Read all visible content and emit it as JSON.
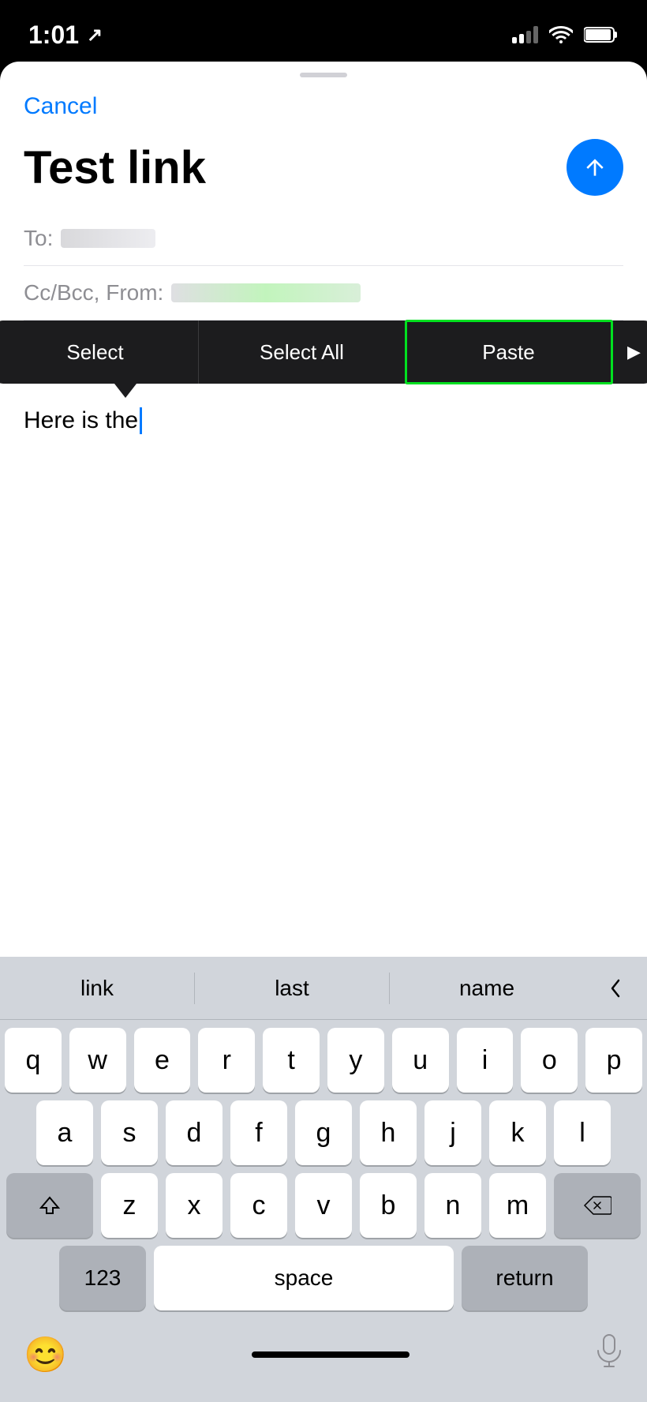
{
  "statusBar": {
    "time": "1:01",
    "locationIcon": "↗"
  },
  "sheet": {
    "cancelLabel": "Cancel",
    "emailTitle": "Test link",
    "toLabel": "To:",
    "ccBccLabel": "Cc/Bcc, From:",
    "bodyText": "Here is the",
    "contextMenu": {
      "selectLabel": "Select",
      "selectAllLabel": "Select All",
      "pasteLabel": "Paste",
      "moreLabel": "▶"
    }
  },
  "keyboard": {
    "predictive": [
      "link",
      "last",
      "name"
    ],
    "rows": [
      [
        "q",
        "w",
        "e",
        "r",
        "t",
        "y",
        "u",
        "i",
        "o",
        "p"
      ],
      [
        "a",
        "s",
        "d",
        "f",
        "g",
        "h",
        "j",
        "k",
        "l"
      ],
      [
        "z",
        "x",
        "c",
        "v",
        "b",
        "n",
        "m"
      ]
    ],
    "spaceLabel": "space",
    "returnLabel": "return",
    "numLabel": "123",
    "emojiLabel": "😊",
    "micLabel": "🎙"
  }
}
